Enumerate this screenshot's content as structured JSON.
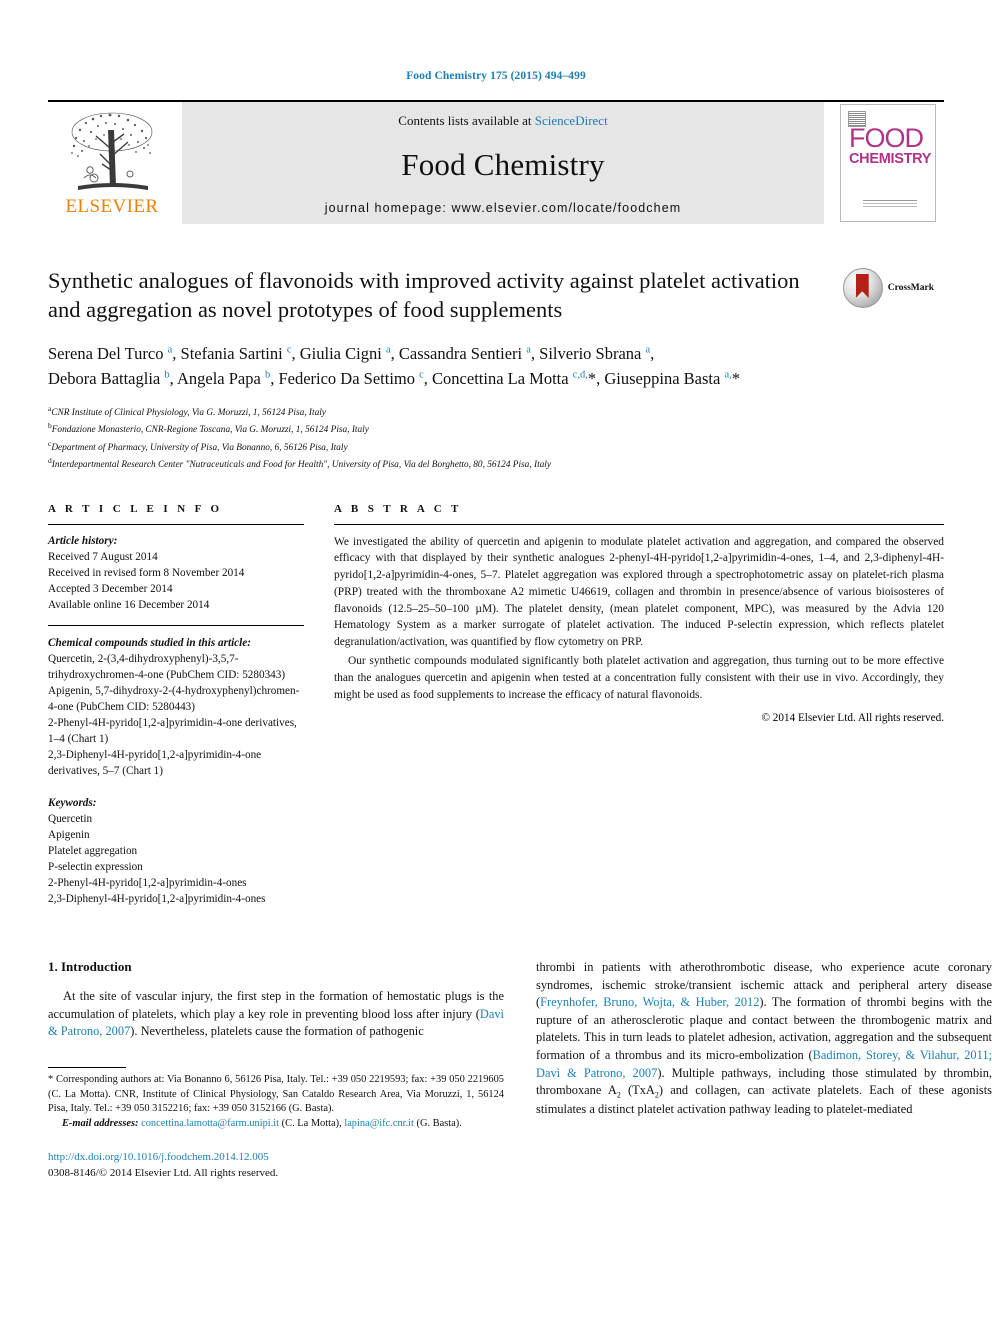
{
  "running_head": "Food Chemistry 175 (2015) 494–499",
  "masthead": {
    "publisher": "ELSEVIER",
    "contents_prefix": "Contents lists available at ",
    "sciencedirect": "ScienceDirect",
    "journal_name": "Food Chemistry",
    "homepage": "journal homepage: www.elsevier.com/locate/foodchem",
    "cover": {
      "title_top": "FOOD",
      "title_bottom": "CHEMISTRY"
    }
  },
  "article": {
    "title": "Synthetic analogues of flavonoids with improved activity against platelet activation and aggregation as novel prototypes of food supplements",
    "crossmark_label": "CrossMark",
    "authors_line1": "Serena Del Turco a, Stefania Sartini c, Giulia Cigni a, Cassandra Sentieri a, Silverio Sbrana a,",
    "authors_line2": "Debora Battaglia b, Angela Papa b, Federico Da Settimo c, Concettina La Motta c,d,*, Giuseppina Basta a,*",
    "affiliations": [
      {
        "mark": "a",
        "text": "CNR Institute of Clinical Physiology, Via G. Moruzzi, 1, 56124 Pisa, Italy"
      },
      {
        "mark": "b",
        "text": "Fondazione Monasterio, CNR-Regione Toscana, Via G. Moruzzi, 1, 56124 Pisa, Italy"
      },
      {
        "mark": "c",
        "text": "Department of Pharmacy, University of Pisa, Via Bonanno, 6, 56126 Pisa, Italy"
      },
      {
        "mark": "d",
        "text": "Interdepartmental Research Center \"Nutraceuticals and Food for Health\", University of Pisa, Via del Borghetto, 80, 56124 Pisa, Italy"
      }
    ]
  },
  "article_info": {
    "heading": "A R T I C L E    I N F O",
    "history_label": "Article history:",
    "history": [
      "Received 7 August 2014",
      "Received in revised form 8 November 2014",
      "Accepted 3 December 2014",
      "Available online 16 December 2014"
    ],
    "compounds_label": "Chemical compounds studied in this article:",
    "compounds": [
      "Quercetin, 2-(3,4-dihydroxyphenyl)-3,5,7-trihydroxychromen-4-one (PubChem CID: 5280343)",
      "Apigenin, 5,7-dihydroxy-2-(4-hydroxyphenyl)chromen-4-one (PubChem CID: 5280443)",
      "2-Phenyl-4H-pyrido[1,2-a]pyrimidin-4-one derivatives, 1–4 (Chart 1)",
      "2,3-Diphenyl-4H-pyrido[1,2-a]pyrimidin-4-one derivatives, 5–7 (Chart 1)"
    ],
    "keywords_label": "Keywords:",
    "keywords": [
      "Quercetin",
      "Apigenin",
      "Platelet aggregation",
      "P-selectin expression",
      "2-Phenyl-4H-pyrido[1,2-a]pyrimidin-4-ones",
      "2,3-Diphenyl-4H-pyrido[1,2-a]pyrimidin-4-ones"
    ]
  },
  "abstract": {
    "heading": "A B S T R A C T",
    "paragraph1": "We investigated the ability of quercetin and apigenin to modulate platelet activation and aggregation, and compared the observed efficacy with that displayed by their synthetic analogues 2-phenyl-4H-pyrido[1,2-a]pyrimidin-4-ones, 1–4, and 2,3-diphenyl-4H-pyrido[1,2-a]pyrimidin-4-ones, 5–7. Platelet aggregation was explored through a spectrophotometric assay on platelet-rich plasma (PRP) treated with the thromboxane A2 mimetic U46619, collagen and thrombin in presence/absence of various bioisosteres of flavonoids (12.5–25–50–100 µM). The platelet density, (mean platelet component, MPC), was measured by the Advia 120 Hematology System as a marker surrogate of platelet activation. The induced P-selectin expression, which reflects platelet degranulation/activation, was quantified by flow cytometry on PRP.",
    "paragraph2": "Our synthetic compounds modulated significantly both platelet activation and aggregation, thus turning out to be more effective than the analogues quercetin and apigenin when tested at a concentration fully consistent with their use in vivo. Accordingly, they might be used as food supplements to increase the efficacy of natural flavonoids.",
    "copyright": "© 2014 Elsevier Ltd. All rights reserved."
  },
  "introduction": {
    "heading": "1. Introduction",
    "left_paragraph": "At the site of vascular injury, the first step in the formation of hemostatic plugs is the accumulation of platelets, which play a key role in preventing blood loss after injury (Davì & Patrono, 2007). Nevertheless, platelets cause the formation of pathogenic",
    "right_paragraph": "thrombi in patients with atherothrombotic disease, who experience acute coronary syndromes, ischemic stroke/transient ischemic attack and peripheral artery disease (Freynhofer, Bruno, Wojta, & Huber, 2012). The formation of thrombi begins with the rupture of an atherosclerotic plaque and contact between the thrombogenic matrix and platelets. This in turn leads to platelet adhesion, activation, aggregation and the subsequent formation of a thrombus and its micro-embolization (Badimon, Storey, & Vilahur, 2011; Davì & Patrono, 2007). Multiple pathways, including those stimulated by thrombin, thromboxane A2 (TxA2) and collagen, can activate platelets. Each of these agonists stimulates a distinct platelet activation pathway leading to platelet-mediated"
  },
  "footnotes": {
    "corresponding": "* Corresponding authors at: Via Bonanno 6, 56126 Pisa, Italy. Tel.: +39 050 2219593; fax: +39 050 2219605 (C. La Motta). CNR, Institute of Clinical Physiology, San Cataldo Research Area, Via Moruzzi, 1, 56124 Pisa, Italy. Tel.: +39 050 3152216; fax: +39 050 3152166 (G. Basta).",
    "email_label": "E-mail addresses:",
    "email1": "concettina.lamotta@farm.unipi.it",
    "email1_owner": "(C. La Motta),",
    "email2": "lapina@ifc.cnr.it",
    "email2_owner": "(G. Basta).",
    "doi": "http://dx.doi.org/10.1016/j.foodchem.2014.12.005",
    "issn": "0308-8146/© 2014 Elsevier Ltd. All rights reserved."
  },
  "colors": {
    "link": "#1a7fb5",
    "elsevier_orange": "#f08000",
    "cover_magenta": "#b0338a",
    "band_gray": "#e6e6e6"
  }
}
